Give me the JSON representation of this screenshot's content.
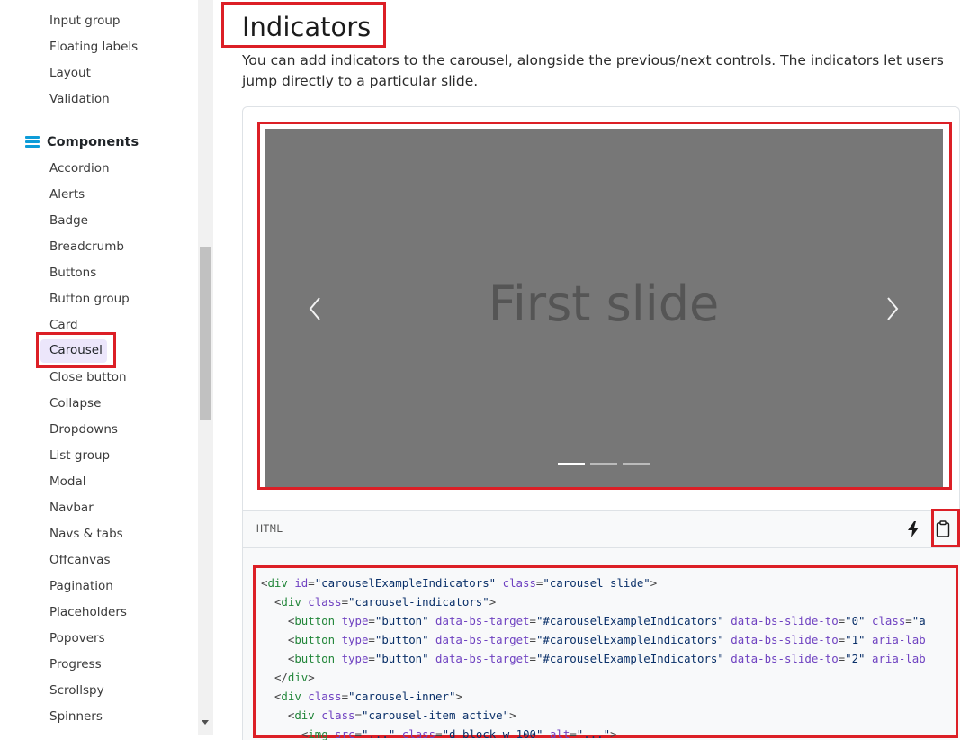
{
  "sidebar": {
    "forms_items": [
      "Input group",
      "Floating labels",
      "Layout",
      "Validation"
    ],
    "group_label": "Components",
    "group_icon": "list-icon",
    "items": [
      "Accordion",
      "Alerts",
      "Badge",
      "Breadcrumb",
      "Buttons",
      "Button group",
      "Card",
      "Carousel",
      "Close button",
      "Collapse",
      "Dropdowns",
      "List group",
      "Modal",
      "Navbar",
      "Navs & tabs",
      "Offcanvas",
      "Pagination",
      "Placeholders",
      "Popovers",
      "Progress",
      "Scrollspy",
      "Spinners"
    ],
    "active_item": "Carousel"
  },
  "main": {
    "heading": "Indicators",
    "lead_text": "You can add indicators to the carousel, alongside the previous/next controls. The indicators let users jump directly to a particular slide.",
    "carousel": {
      "slide_label": "First slide",
      "indicator_count": 3,
      "active_indicator": 0,
      "background_color": "#777777"
    },
    "code": {
      "language": "HTML",
      "lines": [
        "<div id=\"carouselExampleIndicators\" class=\"carousel slide\">",
        "  <div class=\"carousel-indicators\">",
        "    <button type=\"button\" data-bs-target=\"#carouselExampleIndicators\" data-bs-slide-to=\"0\" class=\"a",
        "    <button type=\"button\" data-bs-target=\"#carouselExampleIndicators\" data-bs-slide-to=\"1\" aria-lab",
        "    <button type=\"button\" data-bs-target=\"#carouselExampleIndicators\" data-bs-slide-to=\"2\" aria-lab",
        "  </div>",
        "  <div class=\"carousel-inner\">",
        "    <div class=\"carousel-item active\">",
        "      <img src=\"...\" class=\"d-block w-100\" alt=\"...\">"
      ]
    }
  },
  "colors": {
    "annotation_red": "#dc1f26",
    "active_bg": "#ece6fb",
    "group_icon_color": "#0d9cd8",
    "tag_color": "#22863a",
    "attr_color": "#6f42c1",
    "string_color": "#0a3069"
  }
}
